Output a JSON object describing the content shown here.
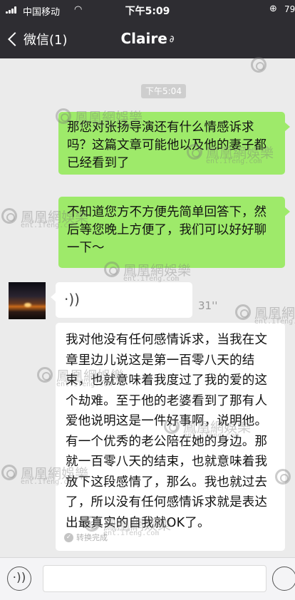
{
  "status_bar": {
    "carrier": "中国移动",
    "time": "下午5:09",
    "battery": "79"
  },
  "nav": {
    "back_label": "微信(1)",
    "title": "Claire"
  },
  "messages": {
    "time_divider": "下午5:04",
    "outgoing": [
      "那您对张扬导演还有什么情感诉求吗？这篇文章可能他以及他的妻子都已经看到了",
      "不知道您方不方便先简单回答下，然后等您晚上方便了，我们可以好好聊一下～"
    ],
    "voice": {
      "duration": "31''"
    },
    "transcription": "我对他没有任何感情诉求，当我在文章里边儿说这是第一百零八天的结束，也就意味着我度过了我的爱的这个劫难。至于他的老婆看到了那有人爱他说明这是一件好事啊，说明他。有一个优秀的老公陪在她的身边。那就一百零八天的结束，也就意味着我放下这段感情了，那么。我也就过去了，所以没有任何感情诉求就是表达出最真实的自我就OK了。",
    "transcription_status": "转换完成"
  },
  "watermark": {
    "name": "鳳凰網娛樂",
    "url": "ent.ifeng.com"
  },
  "icons": {
    "back": "chevron-left-icon",
    "ear": "ear-icon",
    "voice": "voice-wave-icon",
    "emoji": "emoji-icon"
  },
  "colors": {
    "nav_background": "#2e2d32",
    "chat_background": "#ebebeb",
    "outgoing_bubble": "#9eea6a",
    "incoming_bubble": "#ffffff"
  }
}
